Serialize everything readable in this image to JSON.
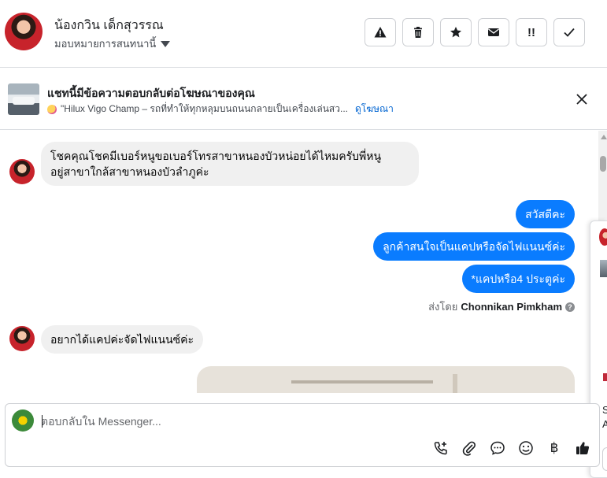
{
  "header": {
    "contact_name": "น้องกวิน เด็กสุวรรณ",
    "assign_label": "มอบหมายการสนทนานี้",
    "actions": {
      "spam_label": "!",
      "mark_important_label": "!!"
    }
  },
  "ad_banner": {
    "title": "แชทนี้มีข้อความตอบกลับต่อโฆษณาของคุณ",
    "ad_text": "\"Hilux Vigo Champ – รถที่ทำให้ทุกหลุมบนถนนกลายเป็นเครื่องเล่นสว...",
    "view_ad_link": "ดูโฆษณา"
  },
  "thread": {
    "messages": [
      {
        "direction": "in",
        "text_line1": "โชคคุณโชคมีเบอร์หนูขอเบอร์โทรสาขาหนองบัวหน่อยได้ไหมครับพี่หนู",
        "text_line2": "อยู่สาขาใกล้สาขาหนองบัวลำภูค่ะ"
      },
      {
        "direction": "out",
        "text": "สวัสดีคะ"
      },
      {
        "direction": "out",
        "text": "ลูกค้าสนใจเป็นแคปหรือจัดไฟแนนซ์ค่ะ"
      },
      {
        "direction": "out",
        "text": "*แคปหรือ4 ประตูค่ะ"
      },
      {
        "direction": "in",
        "text": "อยากได้แคปค่ะจัดไฟแนนซ์ค่ะ"
      }
    ],
    "sent_by_prefix": "ส่งโดย",
    "sent_by_name": "Chonnikan Pimkham",
    "info_glyph": "?"
  },
  "side_peek": {
    "text_line1": "S",
    "text_line2": "A"
  },
  "composer": {
    "placeholder": "ตอบกลับใน Messenger...",
    "baht_symbol": "฿"
  },
  "colors": {
    "outgoing_bubble": "#0a7cff",
    "incoming_bubble": "#f0f0f0",
    "link": "#0064d1"
  },
  "icons": [
    "alert-triangle-icon",
    "trash-icon",
    "star-icon",
    "envelope-icon",
    "double-exclamation-icon",
    "check-icon",
    "close-icon",
    "call-add-icon",
    "paperclip-icon",
    "chat-bubble-icon",
    "emoji-icon",
    "baht-icon",
    "thumbs-up-icon"
  ]
}
